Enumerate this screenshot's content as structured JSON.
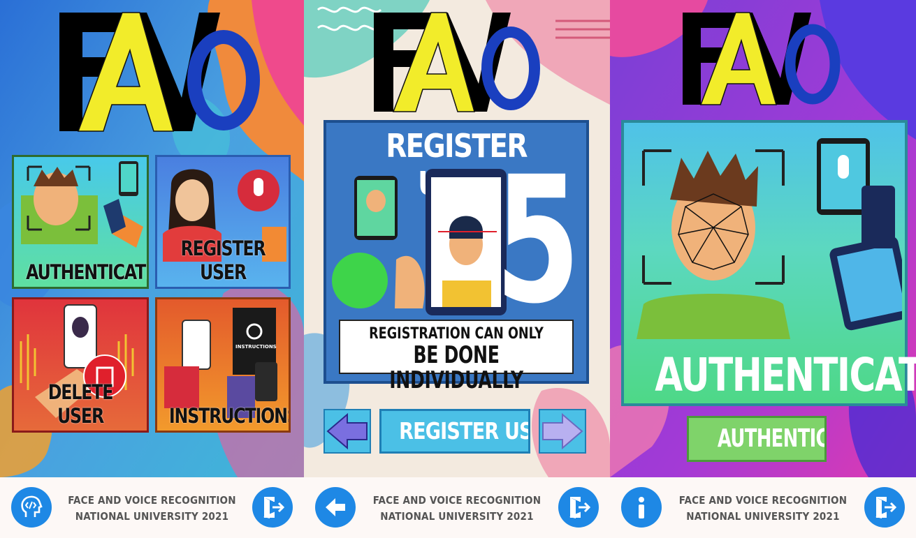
{
  "logo": {
    "text_f": "F",
    "text_a": "A",
    "text_v": "V",
    "text_o": "o"
  },
  "screen_home": {
    "tiles": [
      {
        "label": "AUTHENTICATE"
      },
      {
        "label": "REGISTER USER"
      },
      {
        "label": "DELETE USER"
      },
      {
        "label": "INSTRUCTIONS"
      }
    ],
    "instructions_book_label": "INSTRUCTIONS"
  },
  "screen_register": {
    "panel_title": "REGISTER USER",
    "big_number": "5",
    "note_line1": "REGISTRATION CAN ONLY",
    "note_line2": "BE DONE INDIVIDUALLY",
    "button_label": "REGISTER USER"
  },
  "screen_authenticate": {
    "panel_label": "AUTHENTICATE",
    "button_label": "AUTHENTICATE"
  },
  "footer": {
    "line1": "FACE AND VOICE RECOGNITION",
    "line2": "NATIONAL UNIVERSITY 2021"
  },
  "colors": {
    "footer_button": "#1e88e5",
    "logo_black": "#000000",
    "logo_yellow": "#f2ec2a",
    "logo_blue": "#1a3fbf"
  },
  "icons": {
    "screen1_left": "head-code-icon",
    "screen2_left": "arrow-left-icon",
    "screen3_left": "info-icon",
    "exit": "exit-door-icon"
  }
}
